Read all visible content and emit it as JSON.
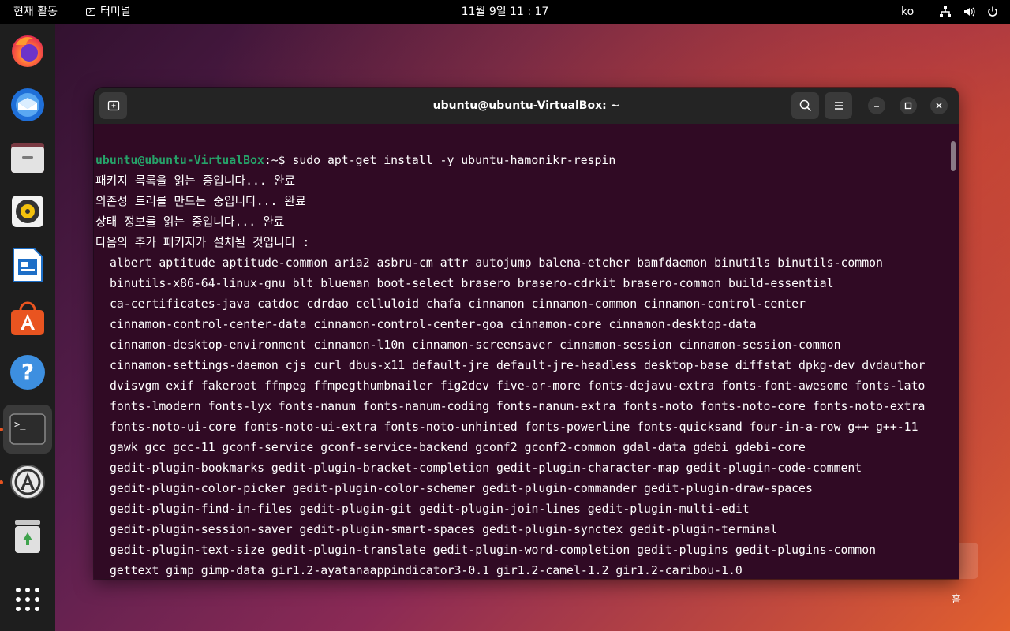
{
  "topbar": {
    "activities": "현재 활동",
    "app_name": "터미널",
    "clock": "11월 9일  11 : 17",
    "lang": "ko"
  },
  "dock": {
    "items": [
      {
        "name": "firefox-icon"
      },
      {
        "name": "thunderbird-icon"
      },
      {
        "name": "files-icon"
      },
      {
        "name": "rhythmbox-icon"
      },
      {
        "name": "libreoffice-writer-icon"
      },
      {
        "name": "app-center-icon"
      },
      {
        "name": "help-icon"
      },
      {
        "name": "terminal-icon"
      },
      {
        "name": "software-updater-icon"
      },
      {
        "name": "trash-icon"
      },
      {
        "name": "show-apps-icon"
      }
    ]
  },
  "terminal": {
    "title": "ubuntu@ubuntu-VirtualBox: ~",
    "prompt_user": "ubuntu@ubuntu-VirtualBox",
    "prompt_suffix": ":~$ ",
    "command": "sudo apt-get install -y ubuntu-hamonikr-respin",
    "output": [
      "패키지 목록을 읽는 중입니다... 완료",
      "의존성 트리를 만드는 중입니다... 완료",
      "상태 정보를 읽는 중입니다... 완료",
      "다음의 추가 패키지가 설치될 것입니다 :"
    ],
    "packages": [
      "albert aptitude aptitude-common aria2 asbru-cm attr autojump balena-etcher bamfdaemon binutils binutils-common",
      "binutils-x86-64-linux-gnu blt blueman boot-select brasero brasero-cdrkit brasero-common build-essential",
      "ca-certificates-java catdoc cdrdao celluloid chafa cinnamon cinnamon-common cinnamon-control-center",
      "cinnamon-control-center-data cinnamon-control-center-goa cinnamon-core cinnamon-desktop-data",
      "cinnamon-desktop-environment cinnamon-l10n cinnamon-screensaver cinnamon-session cinnamon-session-common",
      "cinnamon-settings-daemon cjs curl dbus-x11 default-jre default-jre-headless desktop-base diffstat dpkg-dev dvdauthor",
      "dvisvgm exif fakeroot ffmpeg ffmpegthumbnailer fig2dev five-or-more fonts-dejavu-extra fonts-font-awesome fonts-lato",
      "fonts-lmodern fonts-lyx fonts-nanum fonts-nanum-coding fonts-nanum-extra fonts-noto fonts-noto-core fonts-noto-extra",
      "fonts-noto-ui-core fonts-noto-ui-extra fonts-noto-unhinted fonts-powerline fonts-quicksand four-in-a-row g++ g++-11",
      "gawk gcc gcc-11 gconf-service gconf-service-backend gconf2 gconf2-common gdal-data gdebi gdebi-core",
      "gedit-plugin-bookmarks gedit-plugin-bracket-completion gedit-plugin-character-map gedit-plugin-code-comment",
      "gedit-plugin-color-picker gedit-plugin-color-schemer gedit-plugin-commander gedit-plugin-draw-spaces",
      "gedit-plugin-find-in-files gedit-plugin-git gedit-plugin-join-lines gedit-plugin-multi-edit",
      "gedit-plugin-session-saver gedit-plugin-smart-spaces gedit-plugin-synctex gedit-plugin-terminal",
      "gedit-plugin-text-size gedit-plugin-translate gedit-plugin-word-completion gedit-plugins gedit-plugins-common",
      "gettext gimp gimp-data gir1.2-ayatanaappindicator3-0.1 gir1.2-camel-1.2 gir1.2-caribou-1.0"
    ]
  },
  "desktop": {
    "home_label": "홈"
  },
  "colors": {
    "terminal_bg": "#300a24",
    "prompt_green": "#26a269",
    "accent": "#e95420"
  }
}
